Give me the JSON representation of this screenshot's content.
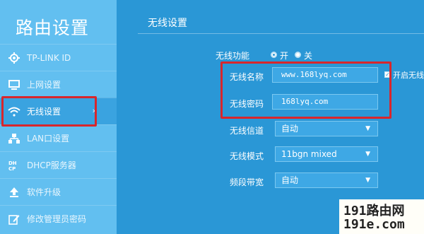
{
  "sidebar": {
    "title": "路由设置",
    "items": [
      {
        "label": "TP-LINK ID",
        "icon": "gear-icon"
      },
      {
        "label": "上网设置",
        "icon": "monitor-icon"
      },
      {
        "label": "无线设置",
        "icon": "wifi-icon",
        "active": true
      },
      {
        "label": "LAN口设置",
        "icon": "network-icon"
      },
      {
        "label": "DHCP服务器",
        "icon": "dhcp-icon"
      },
      {
        "label": "软件升级",
        "icon": "upload-icon"
      },
      {
        "label": "修改管理员密码",
        "icon": "edit-icon"
      }
    ],
    "active_chevron": "›"
  },
  "main": {
    "section_title": "无线设置",
    "wireless_function": {
      "label": "无线功能",
      "on_label": "开",
      "off_label": "关",
      "selected": "开"
    },
    "ssid": {
      "label": "无线名称",
      "value": "www.168lyq.com"
    },
    "hide_ssid": {
      "label": "开启无线"
    },
    "password": {
      "label": "无线密码",
      "value": "168lyq.com"
    },
    "channel": {
      "label": "无线信道",
      "value": "自动"
    },
    "mode": {
      "label": "无线模式",
      "value": "11bgn mixed"
    },
    "bandwidth": {
      "label": "频段带宽",
      "value": "自动"
    }
  },
  "colors": {
    "sidebar_bg": "#62bff0",
    "main_bg": "#2a97d6",
    "highlight": "#d8262c"
  },
  "watermark": {
    "line1": "191路由网",
    "line2": "191e.com"
  }
}
